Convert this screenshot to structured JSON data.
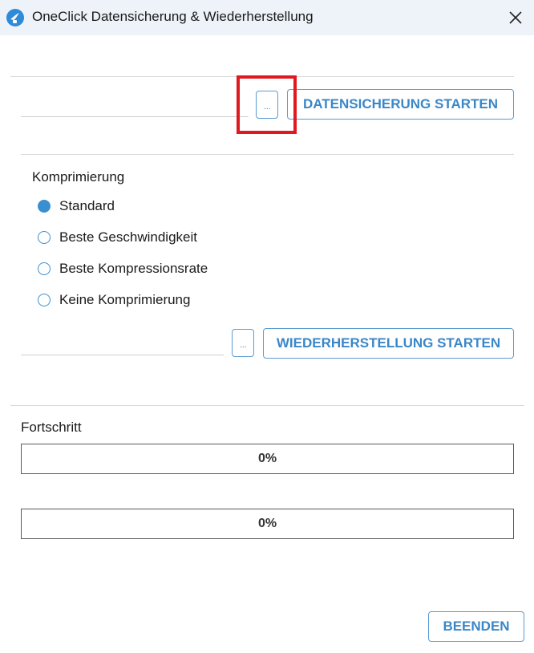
{
  "window": {
    "title": "OneClick Datensicherung & Wiederherstellung",
    "icon": "app-logo-icon",
    "close_icon": "close-icon"
  },
  "backup": {
    "path_value": "",
    "browse_label": "...",
    "start_label": "DATENSICHERUNG STARTEN"
  },
  "compression": {
    "label": "Komprimierung",
    "options": [
      {
        "label": "Standard",
        "checked": true
      },
      {
        "label": "Beste Geschwindigkeit",
        "checked": false
      },
      {
        "label": "Beste Kompressionsrate",
        "checked": false
      },
      {
        "label": "Keine Komprimierung",
        "checked": false
      }
    ]
  },
  "restore": {
    "path_value": "",
    "browse_label": "...",
    "start_label": "WIEDERHERSTELLUNG STARTEN"
  },
  "progress": {
    "label": "Fortschritt",
    "bars": [
      {
        "text": "0%",
        "value": 0
      },
      {
        "text": "0%",
        "value": 0
      }
    ]
  },
  "footer": {
    "finish_label": "BEENDEN"
  },
  "colors": {
    "accent": "#3a87c8",
    "highlight": "#e0181f",
    "titlebar": "#eef3f9"
  }
}
